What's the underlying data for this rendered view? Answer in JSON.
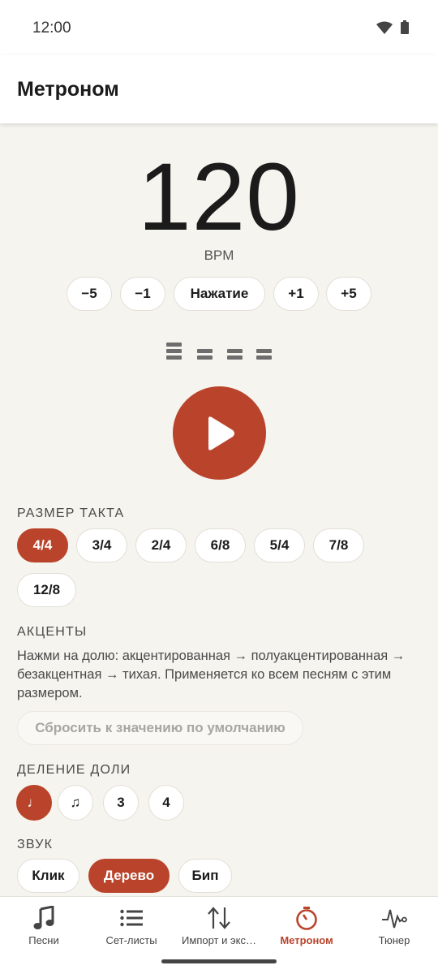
{
  "status": {
    "time": "12:00"
  },
  "app": {
    "title": "Метроном"
  },
  "bpm": {
    "value": "120",
    "unit": "BPM"
  },
  "tempo_buttons": [
    {
      "label": "−5"
    },
    {
      "label": "−1"
    },
    {
      "label": "Нажатие"
    },
    {
      "label": "+1"
    },
    {
      "label": "+5"
    }
  ],
  "beats": [
    {
      "level": "accent"
    },
    {
      "level": "normal"
    },
    {
      "level": "normal"
    },
    {
      "level": "normal"
    }
  ],
  "time_signature": {
    "label": "РАЗМЕР ТАКТА",
    "selected": "4/4",
    "options": [
      "4/4",
      "3/4",
      "2/4",
      "6/8",
      "5/4",
      "7/8",
      "12/8"
    ]
  },
  "accents": {
    "label": "АКЦЕНТЫ",
    "description": "Нажми на долю: акцентированная → полуакцентированная → безакцентная → тихая. Применяется ко всем песням с этим размером.",
    "reset_label": "Сбросить к значению по умолчанию"
  },
  "subdivision": {
    "label": "ДЕЛЕНИЕ ДОЛИ",
    "options": [
      "♩",
      "♫",
      "3",
      "4"
    ],
    "selected": "♩"
  },
  "sound": {
    "label": "ЗВУК",
    "options": [
      "Клик",
      "Дерево",
      "Бип"
    ],
    "selected": "Дерево"
  },
  "nav": {
    "items": [
      {
        "label": "Песни",
        "icon": "music-note-icon"
      },
      {
        "label": "Сет-листы",
        "icon": "list-icon"
      },
      {
        "label": "Импорт и экс…",
        "icon": "import-export-icon"
      },
      {
        "label": "Метроном",
        "icon": "metronome-icon"
      },
      {
        "label": "Тюнер",
        "icon": "tuner-wave-icon"
      }
    ],
    "active": "Метроном"
  },
  "colors": {
    "accent": "#b9442b",
    "background": "#f6f4ee"
  }
}
